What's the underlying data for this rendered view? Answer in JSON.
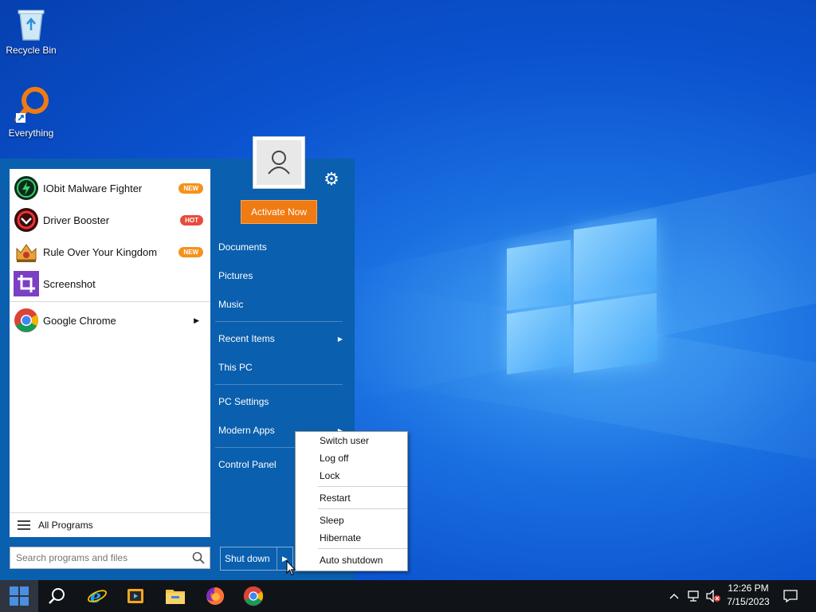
{
  "desktop": {
    "icons": [
      {
        "label": "Recycle Bin",
        "icon": "recycle-bin-icon"
      },
      {
        "label": "Everything",
        "icon": "everything-search-icon"
      }
    ]
  },
  "start_menu": {
    "programs": [
      {
        "label": "IObit Malware Fighter",
        "badge": "NEW",
        "icon": "iobit-malware-fighter-icon"
      },
      {
        "label": "Driver Booster",
        "badge": "HOT",
        "icon": "driver-booster-icon"
      },
      {
        "label": "Rule Over Your Kingdom",
        "badge": "NEW",
        "icon": "kingdom-game-icon"
      },
      {
        "label": "Screenshot",
        "badge": "",
        "icon": "screenshot-crop-icon"
      },
      {
        "label": "Google Chrome",
        "badge": "",
        "icon": "chrome-icon"
      }
    ],
    "all_programs": "All Programs",
    "search_placeholder": "Search programs and files",
    "activate_label": "Activate Now",
    "right_items": {
      "documents": "Documents",
      "pictures": "Pictures",
      "music": "Music",
      "recent_items": "Recent Items",
      "this_pc": "This PC",
      "pc_settings": "PC Settings",
      "modern_apps": "Modern Apps",
      "control_panel": "Control Panel"
    },
    "shutdown_label": "Shut down"
  },
  "power_menu": {
    "switch_user": "Switch user",
    "log_off": "Log off",
    "lock": "Lock",
    "restart": "Restart",
    "sleep": "Sleep",
    "hibernate": "Hibernate",
    "auto_shutdown": "Auto shutdown"
  },
  "taskbar": {
    "time": "12:26 PM",
    "date": "7/15/2023",
    "pinned": [
      "search-icon",
      "internet-explorer-icon",
      "media-player-icon",
      "file-explorer-icon",
      "firefox-icon",
      "chrome-icon"
    ]
  },
  "colors": {
    "menu_blue": "#0a5fae",
    "activate_orange": "#f07b12",
    "badge_new": "#f5921d",
    "badge_hot": "#e74c3c"
  }
}
